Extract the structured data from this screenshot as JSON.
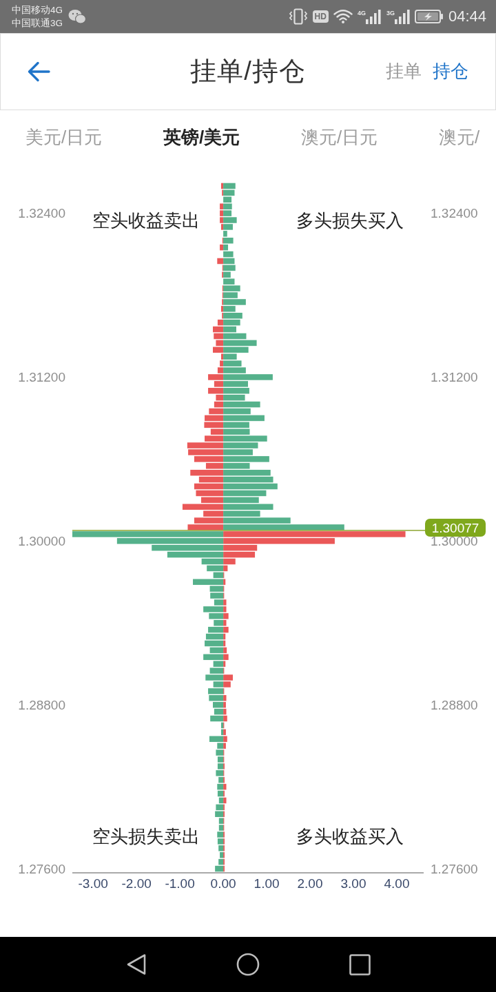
{
  "status_bar": {
    "carriers": [
      "中国移动4G",
      "中国联通3G"
    ],
    "hd_badge": "HD",
    "signals": [
      {
        "network": "4G"
      },
      {
        "network": "3G"
      }
    ],
    "time": "04:44"
  },
  "header": {
    "title": "挂单/持仓",
    "toggles": [
      {
        "label": "挂单",
        "selected": false
      },
      {
        "label": "持仓",
        "selected": true
      }
    ]
  },
  "currency_tabs": [
    {
      "label": "美元/日元",
      "selected": false
    },
    {
      "label": "英镑/美元",
      "selected": true
    },
    {
      "label": "澳元/日元",
      "selected": false
    },
    {
      "label": "澳元/",
      "selected": false
    }
  ],
  "chart": {
    "right_axis_labels": [
      "1.32400",
      "1.31200",
      "1.30000",
      "1.28800",
      "1.27600"
    ],
    "chart_data": {
      "type": "bar",
      "orientation": "horizontal",
      "stacked": true,
      "x": [
        1.326,
        1.3255,
        1.325,
        1.3245,
        1.324,
        1.3235,
        1.323,
        1.3225,
        1.322,
        1.3215,
        1.321,
        1.3205,
        1.32,
        1.3195,
        1.319,
        1.3185,
        1.318,
        1.3175,
        1.317,
        1.3165,
        1.316,
        1.3155,
        1.315,
        1.3145,
        1.314,
        1.3135,
        1.313,
        1.3125,
        1.312,
        1.3115,
        1.311,
        1.3105,
        1.31,
        1.3095,
        1.309,
        1.3085,
        1.308,
        1.3075,
        1.307,
        1.3065,
        1.306,
        1.3055,
        1.305,
        1.3045,
        1.304,
        1.3035,
        1.303,
        1.3025,
        1.302,
        1.3015,
        1.301,
        1.3005,
        1.3,
        1.2995,
        1.299,
        1.2985,
        1.298,
        1.2975,
        1.297,
        1.2965,
        1.296,
        1.2955,
        1.295,
        1.2945,
        1.294,
        1.2935,
        1.293,
        1.2925,
        1.292,
        1.2915,
        1.291,
        1.2905,
        1.29,
        1.2895,
        1.289,
        1.2885,
        1.288,
        1.2875,
        1.287,
        1.2865,
        1.286,
        1.2855,
        1.285,
        1.2845,
        1.284,
        1.2835,
        1.283,
        1.2825,
        1.282,
        1.2815,
        1.281,
        1.2805,
        1.28,
        1.2795,
        1.279,
        1.2785,
        1.278,
        1.2775,
        1.277,
        1.2765,
        1.276
      ],
      "series": [
        {
          "color": "#ea5858",
          "values": [
            -0.05,
            -0.03,
            null,
            -0.08,
            -0.08,
            -0.08,
            -0.05,
            null,
            -0.02,
            -0.08,
            null,
            -0.14,
            -0.02,
            -0.03,
            null,
            -0.02,
            -0.02,
            -0.03,
            -0.05,
            -0.03,
            -0.13,
            -0.24,
            -0.22,
            -0.17,
            -0.24,
            -0.05,
            -0.08,
            -0.13,
            -0.35,
            -0.21,
            -0.35,
            -0.17,
            -0.21,
            -0.33,
            -0.43,
            -0.44,
            -0.29,
            -0.43,
            -0.83,
            -0.81,
            -0.67,
            -0.4,
            -0.76,
            -0.56,
            -0.67,
            -0.63,
            -0.51,
            -0.94,
            -0.46,
            -0.67,
            -0.82,
            4.2,
            2.57,
            0.78,
            0.73,
            0.28,
            0.1,
            0.02,
            0.05,
            0.02,
            0.02,
            0.07,
            0.07,
            0.12,
            0.07,
            0.12,
            0.05,
            0.05,
            0.08,
            0.12,
            0.05,
            0.02,
            0.22,
            0.17,
            0.02,
            0.07,
            0.06,
            0.07,
            0.09,
            0.02,
            0.06,
            0.09,
            0.06,
            0.02,
            0.02,
            0.03,
            0.02,
            0.03,
            0.07,
            0.03,
            0.07,
            0.03,
            0.03,
            0.02,
            0.02,
            0.03,
            0.03,
            0.03,
            0.03,
            0.03,
            0.03
          ]
        },
        {
          "color": "#55b18b",
          "values": [
            0.28,
            0.26,
            0.19,
            0.2,
            0.19,
            0.31,
            0.22,
            0.09,
            0.23,
            0.11,
            0.23,
            0.26,
            0.28,
            0.17,
            0.26,
            0.39,
            0.33,
            0.52,
            0.28,
            0.44,
            0.39,
            0.3,
            0.53,
            0.77,
            0.58,
            0.31,
            0.42,
            0.52,
            1.14,
            0.57,
            0.6,
            0.5,
            0.85,
            0.63,
            0.95,
            0.6,
            0.61,
            1.01,
            0.8,
            0.68,
            1.06,
            0.61,
            1.09,
            1.15,
            1.25,
            0.99,
            0.82,
            1.15,
            0.85,
            1.55,
            2.79,
            -3.48,
            -2.45,
            -1.65,
            -1.29,
            -0.5,
            -0.38,
            -0.23,
            -0.7,
            -0.31,
            -0.3,
            -0.21,
            -0.46,
            -0.33,
            -0.22,
            -0.35,
            -0.4,
            -0.43,
            -0.31,
            -0.46,
            -0.23,
            -0.31,
            -0.41,
            -0.23,
            -0.35,
            -0.33,
            -0.24,
            -0.21,
            -0.3,
            -0.05,
            -0.05,
            -0.32,
            -0.14,
            -0.17,
            -0.13,
            -0.13,
            -0.17,
            -0.11,
            -0.14,
            -0.13,
            -0.1,
            -0.17,
            -0.19,
            -0.1,
            -0.1,
            -0.14,
            -0.13,
            -0.11,
            -0.08,
            -0.11,
            -0.19
          ]
        }
      ],
      "xlim": [
        -3.48,
        4.62
      ],
      "xticks": [
        {
          "value": -3,
          "label": "-3.00"
        },
        {
          "value": -2,
          "label": "-2.00"
        },
        {
          "value": -1,
          "label": "-1.00"
        },
        {
          "value": 0,
          "label": "0.00"
        },
        {
          "value": 1,
          "label": "1.00"
        },
        {
          "value": 2,
          "label": "2.00"
        },
        {
          "value": 3,
          "label": "3.00"
        },
        {
          "value": 4,
          "label": "4.00"
        }
      ],
      "ylim": [
        1.27575,
        1.32625
      ],
      "yticks": [
        {
          "value": 1.324,
          "label": "1.32400"
        },
        {
          "value": 1.312,
          "label": "1.31200"
        },
        {
          "value": 1.3,
          "label": "1.30000"
        },
        {
          "value": 1.288,
          "label": "1.28800"
        },
        {
          "value": 1.276,
          "label": "1.27600"
        }
      ],
      "ref_lines": [
        {
          "axis": "y",
          "value": 1.30077,
          "label": "1.30077"
        }
      ],
      "annotations": [
        "空头收益卖出",
        "多头损失买入",
        "空头损失卖出",
        "多头收益买入"
      ]
    }
  }
}
